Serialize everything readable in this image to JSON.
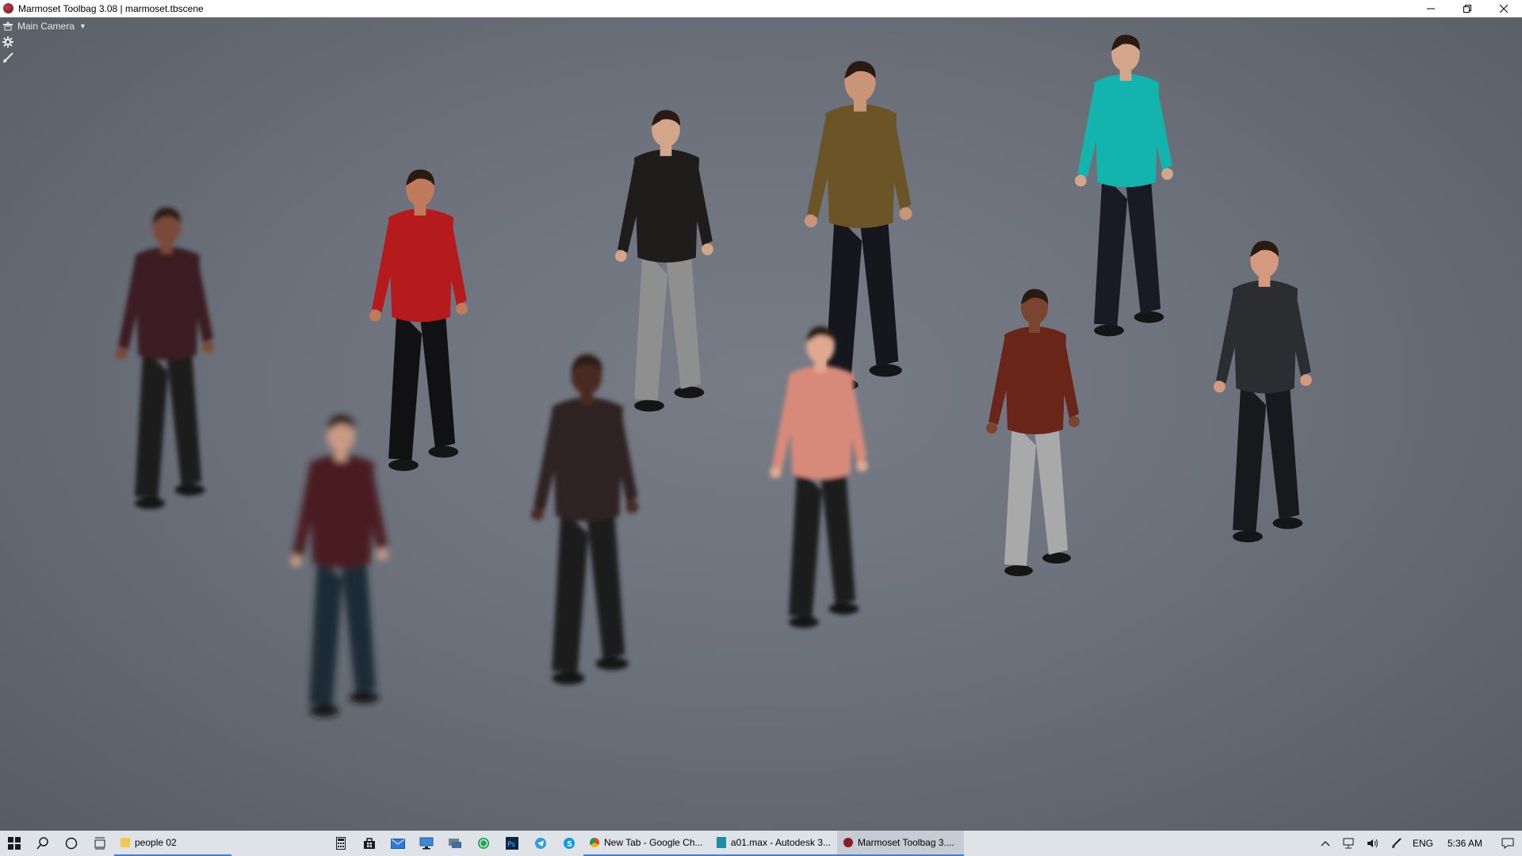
{
  "window": {
    "title": "Marmoset Toolbag 3.08  |  marmoset.tbscene",
    "controls": {
      "minimize": "minimize-icon",
      "restore": "restore-icon",
      "close": "close-icon"
    }
  },
  "viewport": {
    "camera_label": "Main Camera",
    "camera_icon": "camera-icon",
    "settings_icon": "gear-icon",
    "paint_icon": "brush-icon",
    "background_color": "#6c717b",
    "figures": [
      {
        "shirt": "#3a1e22",
        "pants": "#1e1a1c",
        "skin": "#7a4a38"
      },
      {
        "shirt": "#b51a1c",
        "pants": "#111113",
        "skin": "#c07a5c"
      },
      {
        "shirt": "#1f1c1c",
        "pants": "#8f8f8f",
        "skin": "#d3a58a"
      },
      {
        "shirt": "#6b5526",
        "pants": "#15171c",
        "skin": "#c99478"
      },
      {
        "shirt": "#12b4ad",
        "pants": "#191a26",
        "skin": "#d3a58a"
      },
      {
        "shirt": "#4a1e22",
        "pants": "#1f2a34",
        "skin": "#c89a84"
      },
      {
        "shirt": "#2e2220",
        "pants": "#1a1a1c",
        "skin": "#4a2a22"
      },
      {
        "shirt": "#d88a7a",
        "pants": "#1b1b1e",
        "skin": "#e0a890"
      },
      {
        "shirt": "#6a2519",
        "pants": "#a9a9aa",
        "skin": "#7a4530"
      },
      {
        "shirt": "#2b2d31",
        "pants": "#17191c",
        "skin": "#d49a80"
      }
    ]
  },
  "taskbar": {
    "start_icon": "windows-start-icon",
    "search_icon": "search-icon",
    "cortana_icon": "cortana-circle-icon",
    "taskview_icon": "task-view-icon",
    "pinned_icons": [
      "calculator-icon",
      "store-icon",
      "mail-icon",
      "desktop-icon",
      "remote-icon",
      "whatsapp-icon",
      "photoshop-icon",
      "telegram-icon",
      "skype-icon"
    ],
    "apps": [
      {
        "label": "people 02",
        "icon": "folder-icon",
        "color": "#f2c94c"
      },
      {
        "label": "New Tab - Google Ch...",
        "icon": "chrome-icon",
        "color": "#db4437"
      },
      {
        "label": "a01.max - Autodesk 3...",
        "icon": "3dsmax-icon",
        "color": "#1f8ea3"
      },
      {
        "label": "Marmoset Toolbag 3....",
        "icon": "marmoset-icon",
        "color": "#8b1a24"
      }
    ],
    "tray": {
      "chevron_icon": "chevron-up-icon",
      "network_icon": "network-icon",
      "volume_icon": "volume-icon",
      "pen_icon": "pen-icon",
      "language": "ENG",
      "time": "5:36 AM",
      "notification_icon": "notification-icon"
    }
  }
}
